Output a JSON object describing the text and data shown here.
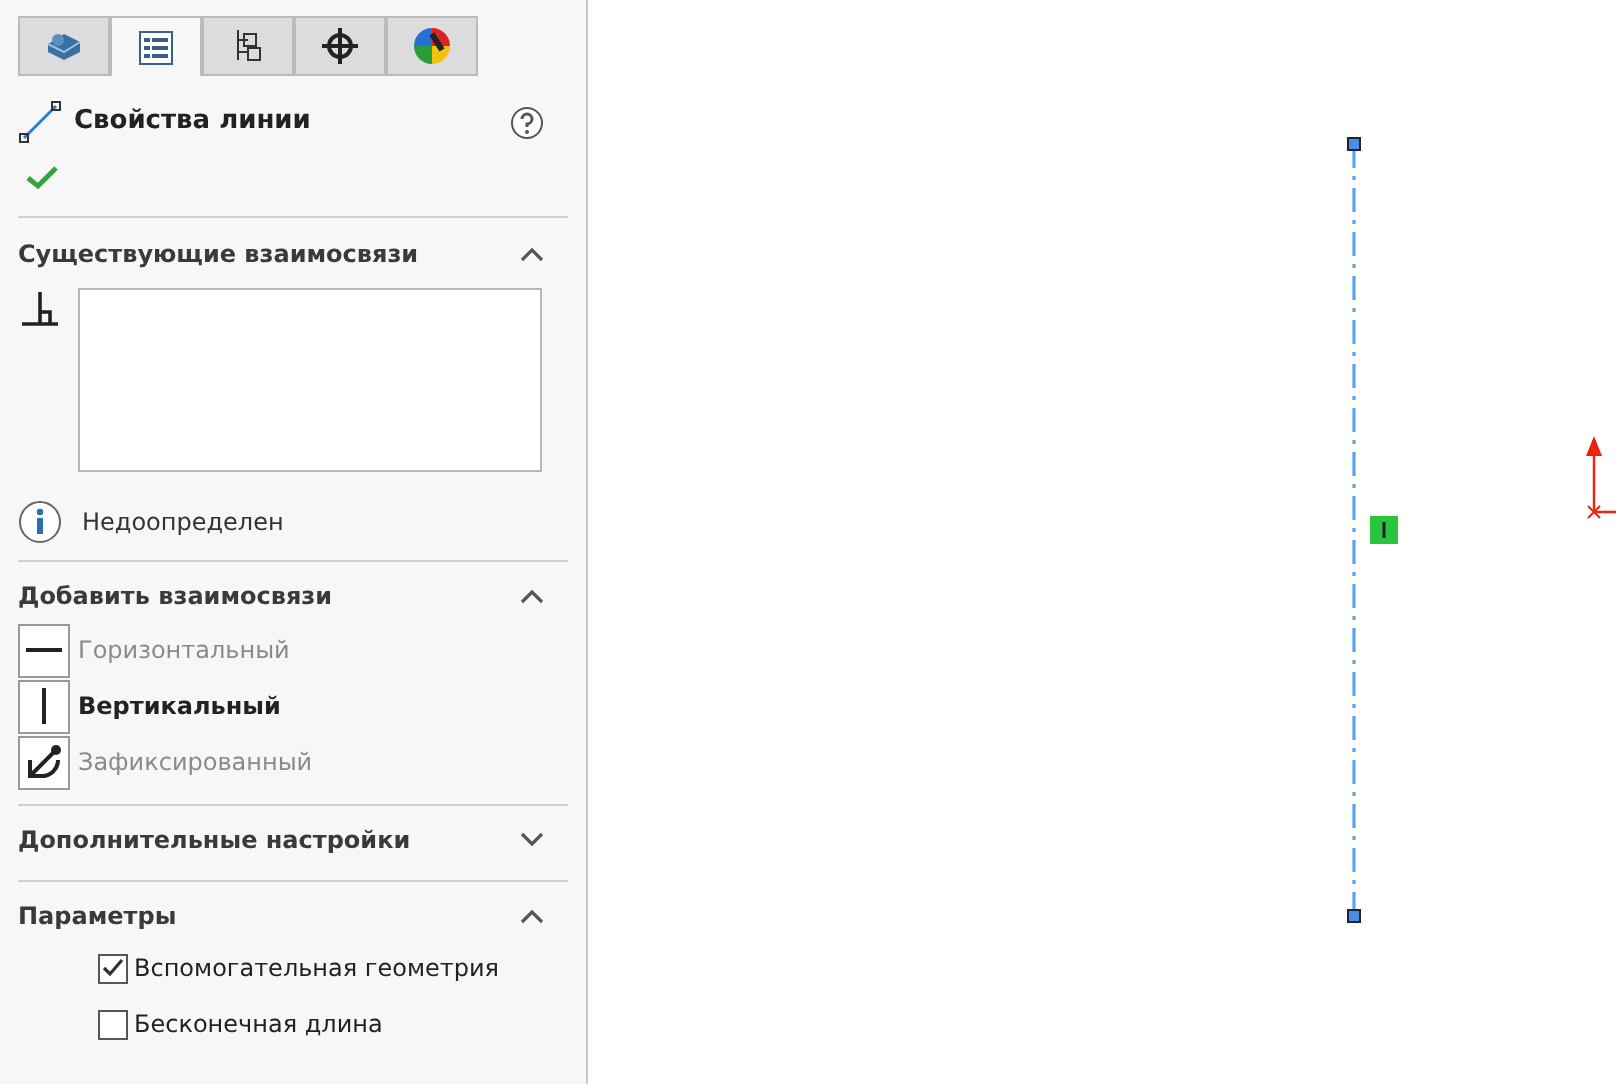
{
  "tabs": [
    {
      "kind": "part",
      "selected": false
    },
    {
      "kind": "properties",
      "selected": true
    },
    {
      "kind": "config",
      "selected": false
    },
    {
      "kind": "target",
      "selected": false
    },
    {
      "kind": "appearance",
      "selected": false
    }
  ],
  "panel": {
    "title": "Свойства линии"
  },
  "sections": [
    {
      "kind": "relations",
      "title": "Существующие взаимосвязи",
      "expanded": true,
      "status": "Недоопределен"
    },
    {
      "kind": "add",
      "title": "Добавить взаимосвязи",
      "expanded": true,
      "items": [
        {
          "kind": "horizontal",
          "label": "Горизонтальный",
          "disabled": true
        },
        {
          "kind": "vertical",
          "label": "Вертикальный",
          "disabled": false
        },
        {
          "kind": "fixed",
          "label": "Зафиксированный",
          "disabled": true
        }
      ]
    },
    {
      "title": "Дополнительные настройки",
      "expanded": false
    },
    {
      "kind": "options",
      "title": "Параметры",
      "expanded": true,
      "options": [
        {
          "label": "Вспомогательная геометрия",
          "checked": true
        },
        {
          "label": "Бесконечная длина",
          "checked": false
        }
      ]
    }
  ]
}
